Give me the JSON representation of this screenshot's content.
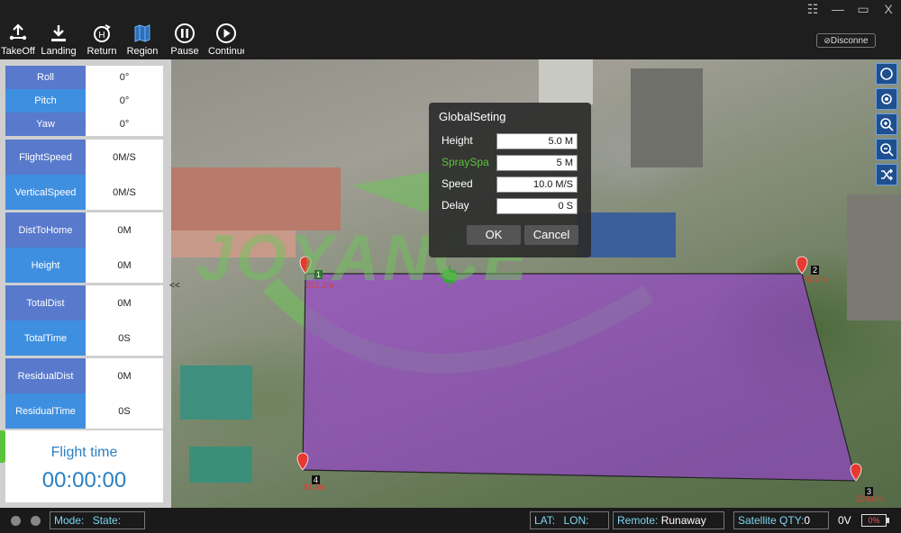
{
  "window": {
    "controls": [
      "☷",
      "—",
      "▭",
      "X"
    ]
  },
  "toolbar": {
    "items": [
      {
        "label": "TakeOff",
        "icon": "takeoff-icon"
      },
      {
        "label": "Landing",
        "icon": "landing-icon"
      },
      {
        "label": "Return",
        "icon": "return-home-icon"
      },
      {
        "label": "Region",
        "icon": "map-region-icon"
      },
      {
        "label": "Pause",
        "icon": "pause-icon"
      },
      {
        "label": "Continue",
        "icon": "play-icon"
      }
    ],
    "disconnect": "Disconne"
  },
  "telemetry": {
    "attitude": [
      {
        "key": "Roll",
        "value": "0°"
      },
      {
        "key": "Pitch",
        "value": "0°"
      },
      {
        "key": "Yaw",
        "value": "0°"
      }
    ],
    "speed": [
      {
        "key": "FlightSpeed",
        "value": "0M/S"
      },
      {
        "key": "VerticalSpeed",
        "value": "0M/S"
      }
    ],
    "position": [
      {
        "key": "DistToHome",
        "value": "0M"
      },
      {
        "key": "Height",
        "value": "0M"
      }
    ],
    "totals": [
      {
        "key": "TotalDist",
        "value": "0M"
      },
      {
        "key": "TotalTime",
        "value": "0S"
      }
    ],
    "residual": [
      {
        "key": "ResidualDist",
        "value": "0M"
      },
      {
        "key": "ResidualTime",
        "value": "0S"
      }
    ],
    "collapse": "<<"
  },
  "flight_time": {
    "label": "Flight time",
    "value": "00:00:00"
  },
  "waypoints": [
    {
      "number": "1",
      "label": "201.2m"
    },
    {
      "number": "2",
      "label": "92.2m"
    },
    {
      "number": "3",
      "label": "224.0m"
    },
    {
      "number": "4",
      "label": "81.5m"
    }
  ],
  "watermark": "JOYANCE",
  "dialog": {
    "title": "GlobalSeting",
    "fields": [
      {
        "label": "Height",
        "value": "5.0 M"
      },
      {
        "label": "SpraySpa",
        "value": "5 M"
      },
      {
        "label": "Speed",
        "value": "10.0 M/S"
      },
      {
        "label": "Delay",
        "value": "0 S"
      }
    ],
    "ok": "OK",
    "cancel": "Cancel"
  },
  "map_controls": [
    "compass-icon",
    "locate-icon",
    "zoom-in-icon",
    "zoom-out-icon",
    "shuffle-icon"
  ],
  "status": {
    "mode_label": "Mode:",
    "state_label": "State:",
    "lat_label": "LAT:",
    "lon_label": "LON:",
    "remote_label": "Remote:",
    "remote_value": "Runaway",
    "satellite_label": "Satellite QTY:",
    "satellite_value": "0",
    "voltage": "0V",
    "battery": "0%"
  },
  "colors": {
    "accent": "#3f8fe0",
    "region_fill": "#9b3fd6",
    "status_text": "#7fd6f2"
  }
}
